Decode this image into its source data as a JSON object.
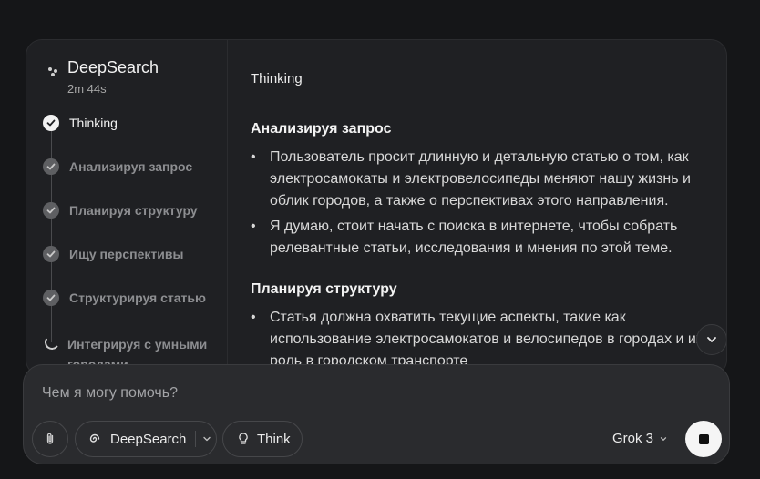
{
  "deepsearch": {
    "title": "DeepSearch",
    "elapsed": "2m 44s",
    "steps": [
      {
        "label": "Thinking",
        "state": "done-active"
      },
      {
        "label": "Анализируя запрос",
        "state": "done"
      },
      {
        "label": "Планируя структуру",
        "state": "done"
      },
      {
        "label": "Ищу перспективы",
        "state": "done"
      },
      {
        "label": "Структурируя статью",
        "state": "done"
      },
      {
        "label": "Интегрируя с умными городами",
        "state": "in-progress"
      }
    ]
  },
  "content": {
    "heading": "Thinking",
    "sections": [
      {
        "title": "Анализируя запрос",
        "bullets": [
          "Пользователь просит длинную и детальную статью о том, как электросамокаты и электровелосипеды меняют нашу жизнь и облик городов, а также о перспективах этого направления.",
          "Я думаю, стоит начать с поиска в интернете, чтобы собрать релевантные статьи, исследования и мнения по этой теме."
        ]
      },
      {
        "title": "Планируя структуру",
        "bullets": [
          "Статья должна охватить текущие аспекты, такие как использование электросамокатов и велосипедов в городах и их роль в городском транспорте"
        ]
      }
    ]
  },
  "composer": {
    "placeholder": "Чем я могу помочь?",
    "deepsearch_label": "DeepSearch",
    "think_label": "Think",
    "model_label": "Grok 3"
  },
  "icons": {
    "attach": "paperclip-icon",
    "deepsearch": "deepsearch-swirl-icon",
    "think": "lightbulb-icon",
    "scroll": "chevron-down-icon",
    "stop": "stop-square-icon"
  }
}
